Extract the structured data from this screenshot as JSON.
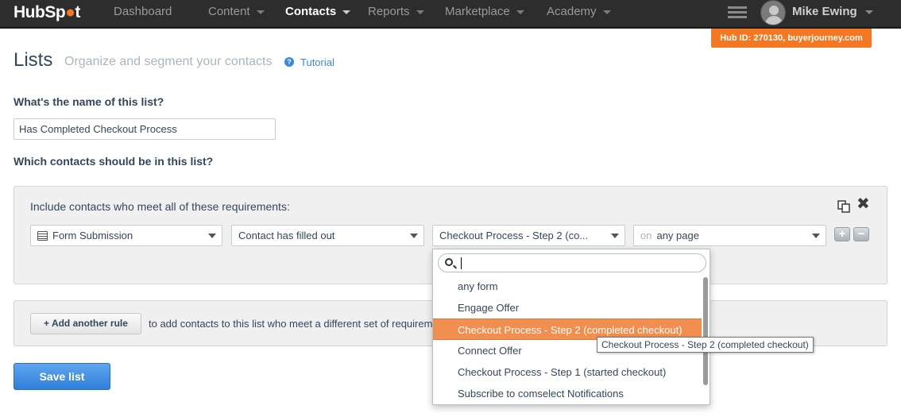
{
  "nav": {
    "logo_a": "HubSp",
    "logo_b": "t",
    "items": [
      {
        "label": "Dashboard"
      },
      {
        "label": "Content"
      },
      {
        "label": "Contacts"
      },
      {
        "label": "Reports"
      },
      {
        "label": "Marketplace"
      },
      {
        "label": "Academy"
      }
    ],
    "user_name": "Mike Ewing",
    "hub_id": "Hub ID: 270130, buyerjourney.com",
    "hub_color": "#f57722"
  },
  "header": {
    "title": "Lists",
    "subtitle": "Organize and segment your contacts",
    "tutorial_icon": "?",
    "tutorial": "Tutorial"
  },
  "form": {
    "name_label": "What's the name of this list?",
    "name_value": "Has Completed Checkout Process",
    "contacts_label": "Which contacts should be in this list?"
  },
  "requirements": {
    "label": "Include contacts who meet all of these requirements:",
    "filter_type": "Form Submission",
    "condition": "Contact has filled out",
    "form_value": "Checkout Process - Step 2 (co...",
    "page_prefix": "on",
    "page_value": "any page",
    "plus": "+",
    "minus": "−",
    "close": "✖"
  },
  "rule": {
    "add_button": "Add another rule",
    "text": "to add contacts to this list who meet a different set of requirem"
  },
  "save_button": "Save list",
  "dropdown": {
    "search_value": "",
    "options": [
      {
        "label": "any form"
      },
      {
        "label": "Engage Offer"
      },
      {
        "label": "Checkout Process - Step 2 (completed checkout)"
      },
      {
        "label": "Connect Offer"
      },
      {
        "label": "Checkout Process - Step 1 (started checkout)"
      },
      {
        "label": "Subscribe to comselect  Notifications"
      }
    ],
    "selected_index": 2,
    "tooltip": "Checkout Process - Step 2 (completed checkout)",
    "highlight_color": "#f08f4f"
  }
}
